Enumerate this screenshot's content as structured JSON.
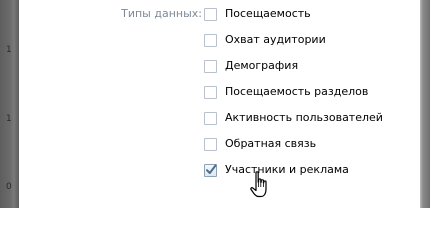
{
  "dialog": {
    "field_label": "Типы данных:",
    "options": [
      {
        "label": "Посещаемость",
        "checked": false
      },
      {
        "label": "Охват аудитории",
        "checked": false
      },
      {
        "label": "Демография",
        "checked": false
      },
      {
        "label": "Посещаемость разделов",
        "checked": false
      },
      {
        "label": "Активность пользователей",
        "checked": false
      },
      {
        "label": "Обратная связь",
        "checked": false
      },
      {
        "label": "Участники и реклама",
        "checked": true
      }
    ]
  },
  "background_ticks": [
    "1",
    "1",
    "0"
  ],
  "colors": {
    "label_gray": "#7f8a96",
    "checkbox_border": "#b9c2cc",
    "checkmark_blue": "#4a6f94"
  },
  "icons": {
    "checkmark": "checkmark-icon",
    "cursor": "hand-cursor-icon"
  }
}
